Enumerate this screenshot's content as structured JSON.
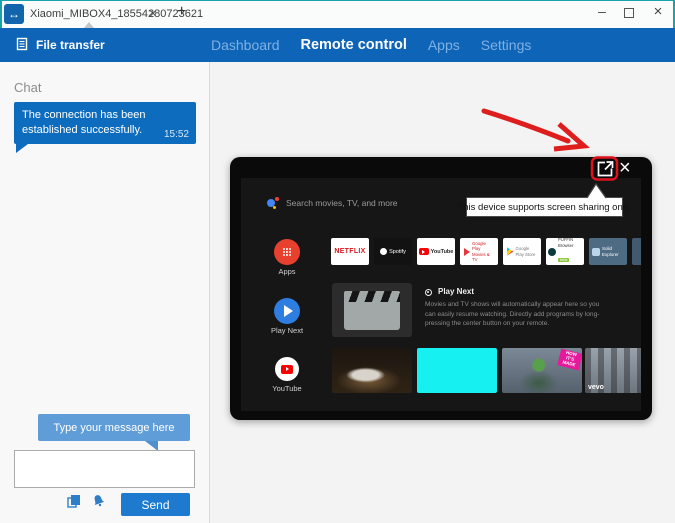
{
  "colors": {
    "window_border_teal": "#18a2aa",
    "navbar_blue": "#0e65b7",
    "nav_inactive_blue": "#7fb0e3",
    "chat_bubble_blue": "#0d6cbe",
    "hint_bubble_blue": "#5f9dd8",
    "send_button_blue": "#1e7ace",
    "annotation_red": "#de1d1d",
    "apps_button_red": "#e8402f",
    "play_next_blue": "#2e7de0"
  },
  "tabbar": {
    "tab_title": "Xiaomi_MIBOX4_18554280723621",
    "tab_close_glyph": "×",
    "new_tab_glyph": "+",
    "window_controls": {
      "minimize": "–",
      "close": "×"
    }
  },
  "navbar": {
    "file_transfer_label": "File transfer",
    "items": [
      {
        "label": "Dashboard",
        "active": false
      },
      {
        "label": "Remote control",
        "active": true
      },
      {
        "label": "Apps",
        "active": false
      },
      {
        "label": "Settings",
        "active": false
      }
    ]
  },
  "chat": {
    "header": "Chat",
    "message": {
      "text": "The connection has been established successfully.",
      "time": "15:52"
    },
    "compose": {
      "hint": "Type your message here",
      "input_value": "",
      "send_label": "Send"
    }
  },
  "remote_view": {
    "share_tooltip": "This device supports screen sharing only.",
    "close_glyph": "×",
    "tv": {
      "search_hint": "Search movies, TV, and more",
      "apps_button_label": "Apps",
      "app_tiles": [
        {
          "label": "NETFLIX"
        },
        {
          "label": "Spotify"
        },
        {
          "label": "YouTube"
        },
        {
          "label": "Google Play Movies & TV"
        },
        {
          "label": "Google Play Store"
        },
        {
          "label": "PUFFIN Browser",
          "badge": "beta"
        },
        {
          "label": "Solid Explorer"
        }
      ],
      "play_next_button_label": "Play Next",
      "play_next_heading": "Play Next",
      "play_next_description": "Movies and TV shows will automatically appear here so you can easily resume watching. Directly add programs by long-pressing the center button on your remote.",
      "youtube_button_label": "YouTube",
      "video_thumbnails": [
        {
          "name": "cat video"
        },
        {
          "name": "blank cyan screen"
        },
        {
          "name": "hulk video",
          "badge": "HOW IT'S MADE"
        },
        {
          "name": "music video",
          "brand": "vevo"
        }
      ]
    }
  }
}
